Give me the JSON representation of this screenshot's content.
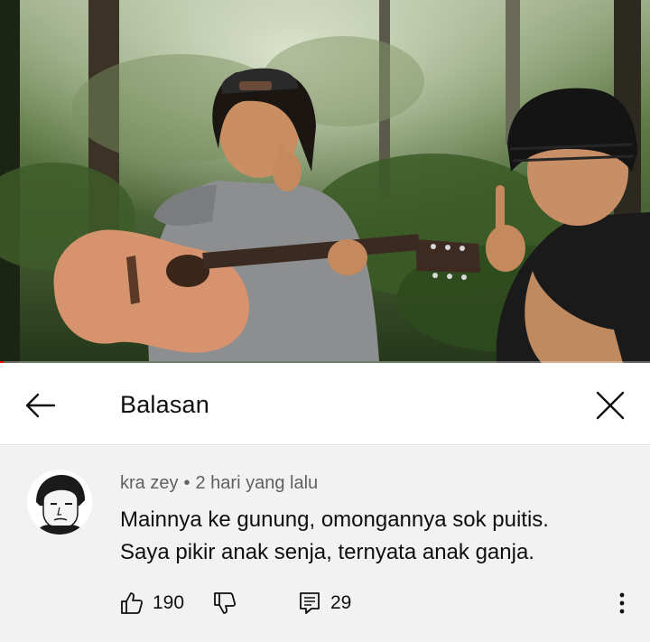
{
  "video": {
    "progress_fraction": 0.006,
    "thumbnail_icon": "video-frame"
  },
  "header": {
    "title": "Balasan",
    "back_icon": "arrow-left-icon",
    "close_icon": "close-icon"
  },
  "comment": {
    "author": "kra zey",
    "separator": "•",
    "time": "2 hari yang lalu",
    "line1": "Mainnya ke gunung, omongannya sok puitis.",
    "line2": "Saya pikir anak senja, ternyata anak ganja.",
    "likes": "190",
    "replies": "29",
    "like_icon": "thumbs-up-icon",
    "dislike_icon": "thumbs-down-icon",
    "reply_icon": "reply-icon",
    "more_icon": "more-vert-icon"
  },
  "colors": {
    "progress": "#ff0000",
    "comment_bg": "#f2f2f2",
    "meta_text": "#606060"
  }
}
